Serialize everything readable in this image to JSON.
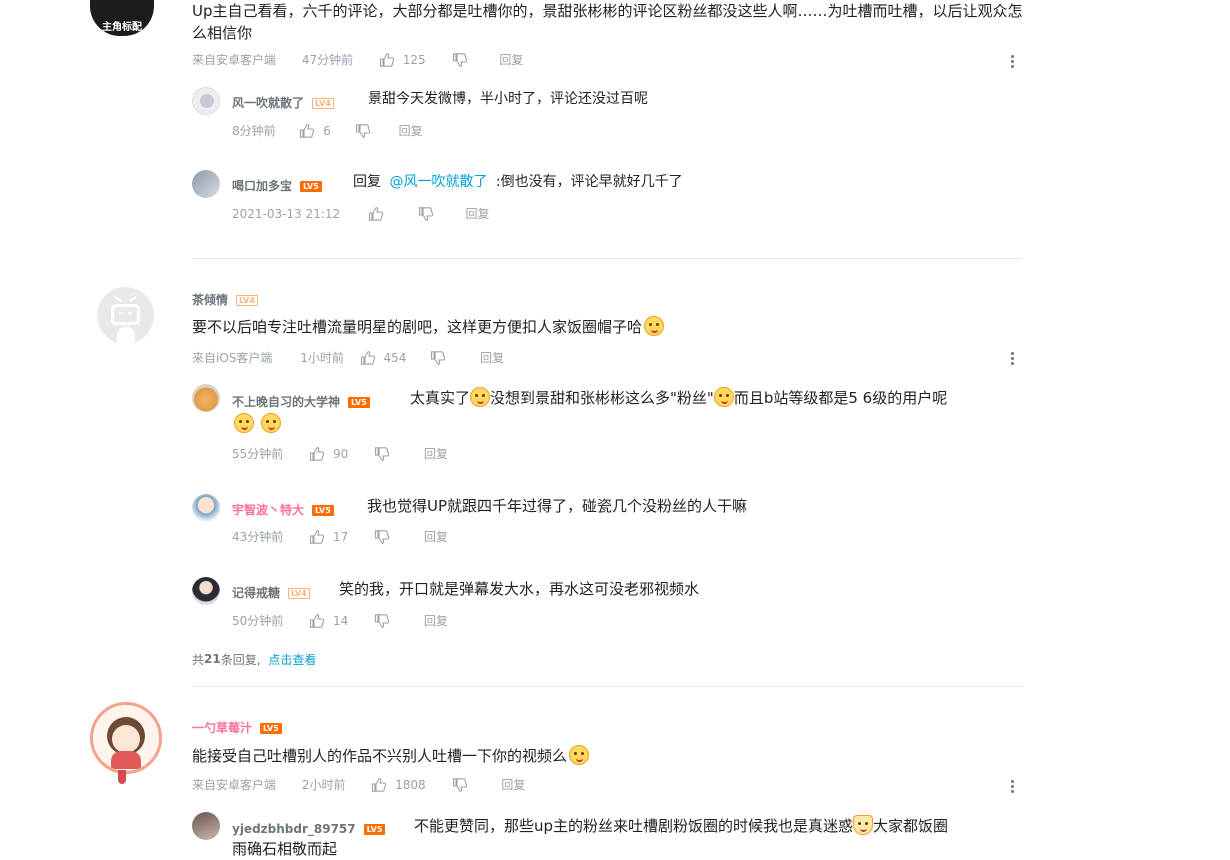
{
  "top_comment": {
    "avatar_label": "主角标配",
    "text": "Up主自己看看，六千的评论，大部分都是吐槽你的，景甜张彬彬的评论区粉丝都没这些人啊……为吐槽而吐槽，以后让观众怎么相信你",
    "source": "来自安卓客户端",
    "time": "47分钟前",
    "likes": "125",
    "reply_label": "回复",
    "replies": [
      {
        "user": "风一吹就散了",
        "level": "LV4",
        "text": "景甜今天发微博，半小时了，评论还没过百呢",
        "time": "8分钟前",
        "likes": "6",
        "reply_label": "回复"
      },
      {
        "user": "喝口加多宝",
        "level": "LV5",
        "prefix": "回复",
        "mention": "@风一吹就散了",
        "text": ":倒也没有，评论早就好几千了",
        "time": "2021-03-13 21:12",
        "likes": "",
        "reply_label": "回复"
      }
    ]
  },
  "comment2": {
    "user": "茶倾情",
    "level": "LV4",
    "text": "要不以后咱专注吐槽流量明星的剧吧，这样更方便扣人家饭圈帽子哈",
    "source": "来自iOS客户端",
    "time": "1小时前",
    "likes": "454",
    "reply_label": "回复",
    "replies": [
      {
        "user": "不上晚自习的大学神",
        "level": "LV5",
        "text_a": "太真实了",
        "text_b": "没想到景甜和张彬彬这么多\"粉丝\"",
        "text_c": "而且b站等级都是5 6级的用户呢",
        "time": "55分钟前",
        "likes": "90",
        "reply_label": "回复"
      },
      {
        "user": "宇智波丶特大",
        "level": "LV5",
        "text": "我也觉得UP就跟四千年过得了，碰瓷几个没粉丝的人干嘛",
        "time": "43分钟前",
        "likes": "17",
        "reply_label": "回复"
      },
      {
        "user": "记得戒糖",
        "level": "LV4",
        "text": "笑的我，开口就是弹幕发大水，再水这可没老邪视频水",
        "time": "50分钟前",
        "likes": "14",
        "reply_label": "回复"
      }
    ],
    "more_prefix": "共",
    "more_count": "21",
    "more_suffix": "条回复,",
    "more_link": "点击查看"
  },
  "comment3": {
    "user": "一勺草莓汁",
    "level": "LV5",
    "text": "能接受自己吐槽别人的作品不兴别人吐槽一下你的视频么",
    "source": "来自安卓客户端",
    "time": "2小时前",
    "likes": "1808",
    "reply_label": "回复",
    "replies": [
      {
        "user": "yjedzbhbdr_89757",
        "level": "LV5",
        "text_a": "不能更赞同，那些up主的粉丝来吐槽剧粉饭圈的时候我也是真迷惑",
        "text_b": "大家都饭圈",
        "text_c": "雨确石相敬而起",
        "time": "",
        "likes": "",
        "reply_label": ""
      }
    ]
  },
  "colors": {
    "accent_blue": "#00a1d6",
    "pink_name": "#fb7299",
    "level5": "#ff6c00",
    "level4": "#ffb37c",
    "meta_gray": "#99a2aa"
  },
  "icons": [
    "thumbs-up-icon",
    "thumbs-down-icon",
    "more-dots-icon",
    "smile-emoji-icon"
  ]
}
